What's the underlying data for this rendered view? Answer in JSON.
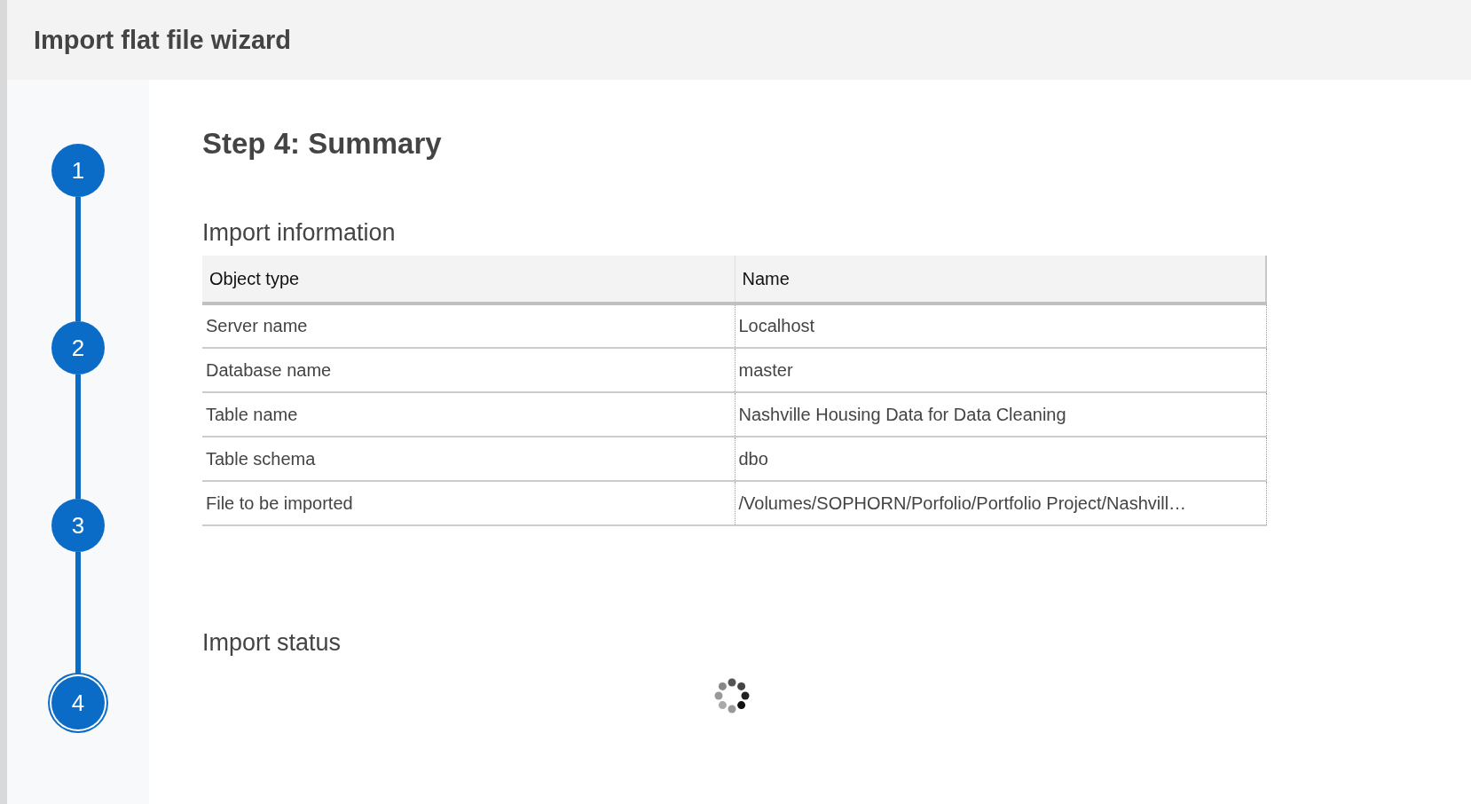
{
  "window": {
    "title": "Import flat file wizard"
  },
  "steps": [
    {
      "label": "1",
      "selected": false
    },
    {
      "label": "2",
      "selected": false
    },
    {
      "label": "3",
      "selected": false
    },
    {
      "label": "4",
      "selected": true
    }
  ],
  "page": {
    "title": "Step 4: Summary"
  },
  "import_information": {
    "heading": "Import information",
    "table": {
      "columns": [
        "Object type",
        "Name"
      ],
      "rows": [
        [
          "Server name",
          "Localhost"
        ],
        [
          "Database name",
          "master"
        ],
        [
          "Table name",
          "Nashville Housing Data for Data Cleaning"
        ],
        [
          "Table schema",
          "dbo"
        ],
        [
          "File to be imported",
          "/Volumes/SOPHORN/Porfolio/Portfolio Project/Nashvill…"
        ]
      ]
    }
  },
  "import_status": {
    "heading": "Import status"
  }
}
